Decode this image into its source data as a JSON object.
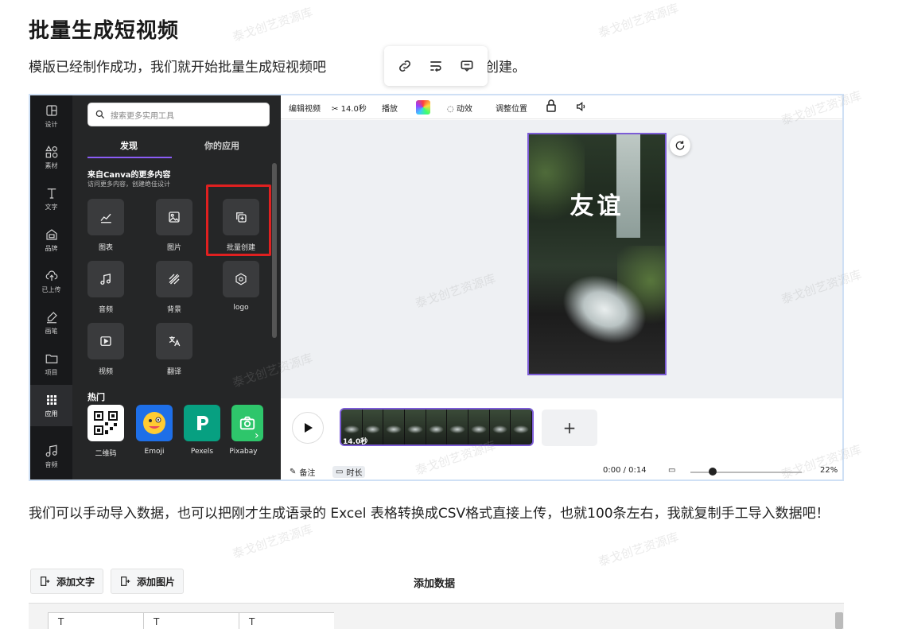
{
  "article": {
    "heading": "批量生成短视频",
    "para1_left": "模版已经制作成功，我们就开始批量生成短视频吧",
    "para1_right": "选择批量创建。",
    "para2": "我们可以手动导入数据，也可以把刚才生成语录的 Excel 表格转换成CSV格式直接上传，也就100条左右，我就复制手工导入数据吧！",
    "watermark": "泰戈创艺资源库"
  },
  "editor": {
    "rail": [
      {
        "label": "设计",
        "icon": "layout-icon"
      },
      {
        "label": "素材",
        "icon": "shapes-icon"
      },
      {
        "label": "文字",
        "icon": "text-icon"
      },
      {
        "label": "品牌",
        "icon": "brand-icon"
      },
      {
        "label": "已上传",
        "icon": "upload-icon"
      },
      {
        "label": "画笔",
        "icon": "draw-icon"
      },
      {
        "label": "项目",
        "icon": "folder-icon"
      },
      {
        "label": "应用",
        "icon": "apps-icon"
      },
      {
        "label": "音频",
        "icon": "music-icon"
      }
    ],
    "search_placeholder": "搜索更多实用工具",
    "tabs": [
      "发现",
      "你的应用"
    ],
    "section_title": "来自Canva的更多内容",
    "section_sub": "访问更多内容，创建绝佳设计",
    "tools": [
      {
        "label": "图表",
        "icon": "chart-icon"
      },
      {
        "label": "图片",
        "icon": "image-icon"
      },
      {
        "label": "批量创建",
        "icon": "bulk-create-icon"
      },
      {
        "label": "音频",
        "icon": "audio-icon"
      },
      {
        "label": "背景",
        "icon": "background-icon"
      },
      {
        "label": "logo",
        "icon": "logo-icon"
      },
      {
        "label": "视频",
        "icon": "video-icon"
      },
      {
        "label": "翻译",
        "icon": "translate-icon"
      }
    ],
    "hot_title": "热门",
    "hot_apps": [
      "二维码",
      "Emoji",
      "Pexels",
      "Pixabay"
    ],
    "toolbar": {
      "edit_video": "编辑视频",
      "duration": "14.0秒",
      "playback": "播放",
      "animate": "动效",
      "position": "调整位置"
    },
    "poster_title": "友谊",
    "clip_duration": "14.0秒",
    "bottom": {
      "notes": "备注",
      "duration": "时长",
      "time": "0:00 / 0:14",
      "zoom": "22%"
    },
    "colors": {
      "accent": "#7c5cd6",
      "highlight": "#e02020",
      "panel": "#252627"
    }
  },
  "float_toolbar": [
    "link-icon",
    "wrap-text-icon",
    "comment-icon"
  ],
  "data_panel": {
    "add_text": "添加文字",
    "add_image": "添加图片",
    "title": "添加数据",
    "col_marker": "T"
  }
}
